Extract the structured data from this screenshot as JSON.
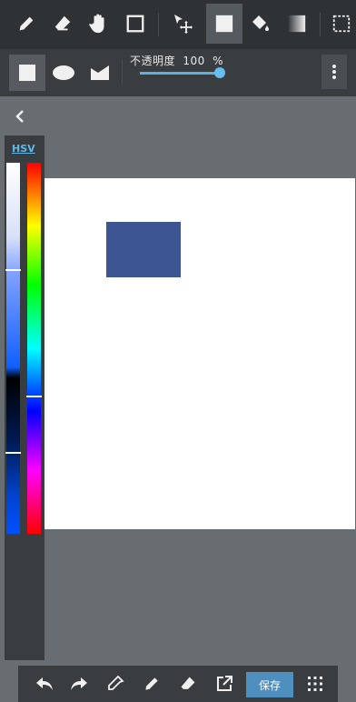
{
  "toolbar": {
    "tools": [
      "pen-icon",
      "eraser-icon",
      "hand-icon",
      "square-select-icon",
      "move-icon",
      "fill-rect-icon",
      "bucket-icon",
      "gradient-icon",
      "selection-icon"
    ],
    "active_tool": "fill-rect-icon"
  },
  "shape_bar": {
    "shapes": [
      "rectangle",
      "ellipse",
      "polygon"
    ],
    "active_shape": "rectangle",
    "opacity_label": "不透明度",
    "opacity_value": "100",
    "opacity_unit": "%",
    "opacity_level": 1.0
  },
  "color_panel": {
    "mode_label": "HSV",
    "selected_color": "#3d5592"
  },
  "canvas": {
    "background": "#ffffff",
    "shape_color": "#3d5592"
  },
  "bottom_bar": {
    "save_label": "保存"
  }
}
